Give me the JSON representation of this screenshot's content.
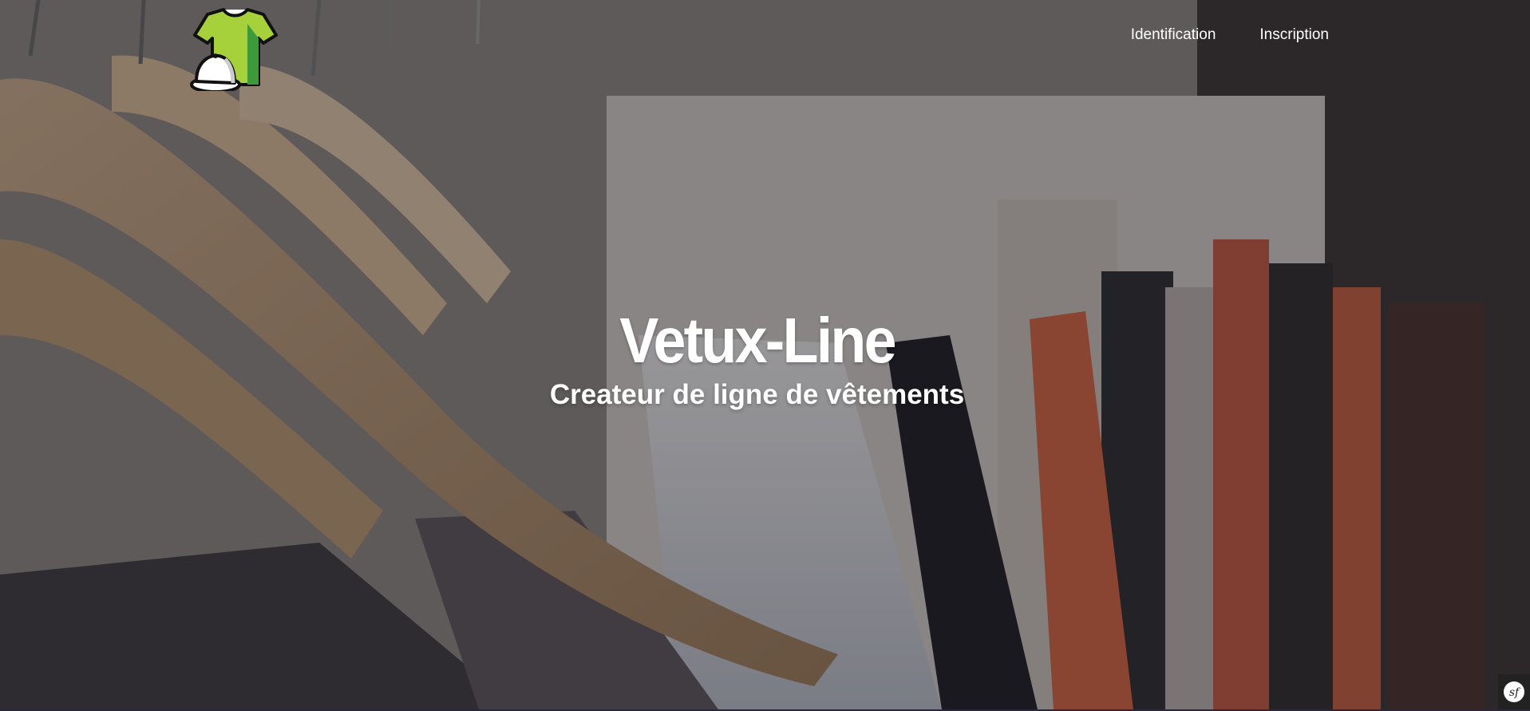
{
  "header": {
    "logo_icon": "tshirt-cap-icon",
    "nav": {
      "identification_label": "Identification",
      "inscription_label": "Inscription"
    }
  },
  "hero": {
    "title": "Vetux-Line",
    "subtitle": "Createur de ligne de vêtements",
    "background": "clothes-on-hangers-photo"
  },
  "debug_toolbar": {
    "icon": "symfony-icon",
    "label": "sf"
  },
  "colors": {
    "logo_shirt": "#a6d13a",
    "logo_shirt_shade": "#3c9a3a",
    "text": "#ffffff"
  }
}
